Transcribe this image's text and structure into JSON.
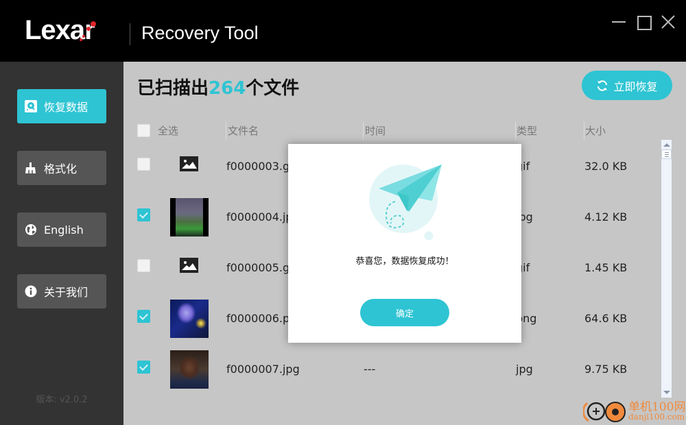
{
  "titlebar": {
    "logo": "Lexar",
    "app_title": "Recovery Tool",
    "minimize": "minimize",
    "maximize": "maximize",
    "close": "close"
  },
  "sidebar": {
    "items": [
      {
        "label": "恢复数据",
        "icon": "drive-recovery-icon",
        "active": true
      },
      {
        "label": "格式化",
        "icon": "broom-icon",
        "active": false
      },
      {
        "label": "English",
        "icon": "globe-icon",
        "active": false
      },
      {
        "label": "关于我们",
        "icon": "info-icon",
        "active": false
      }
    ],
    "version": "版本: v2.0.2"
  },
  "main": {
    "heading_prefix": "已扫描出",
    "file_count": "264",
    "heading_suffix": "个文件",
    "recover_button": "立即恢复",
    "accent_color": "#2ec4d3",
    "columns": {
      "select_all": "全选",
      "name": "文件名",
      "time": "时间",
      "type": "类型",
      "size": "大小"
    },
    "rows": [
      {
        "checked": false,
        "thumb": "placeholder-image",
        "name": "f0000003.gif",
        "time": "---",
        "type": "gif",
        "size": "32.0 KB"
      },
      {
        "checked": true,
        "thumb": "game-screenshot",
        "name": "f0000004.jpg",
        "time": "---",
        "type": "jpg",
        "size": "4.12 KB"
      },
      {
        "checked": false,
        "thumb": "placeholder-image",
        "name": "f0000005.gif",
        "time": "---",
        "type": "gif",
        "size": "1.45 KB"
      },
      {
        "checked": true,
        "thumb": "night-city-image",
        "name": "f0000006.png",
        "time": "---",
        "type": "png",
        "size": "64.6 KB"
      },
      {
        "checked": true,
        "thumb": "portrait-photo",
        "name": "f0000007.jpg",
        "time": "---",
        "type": "jpg",
        "size": "9.75 KB"
      }
    ]
  },
  "modal": {
    "message": "恭喜您，数据恢复成功！",
    "ok_button": "确定"
  },
  "watermark": {
    "cn": "单机100网",
    "en": "danji100.com"
  }
}
